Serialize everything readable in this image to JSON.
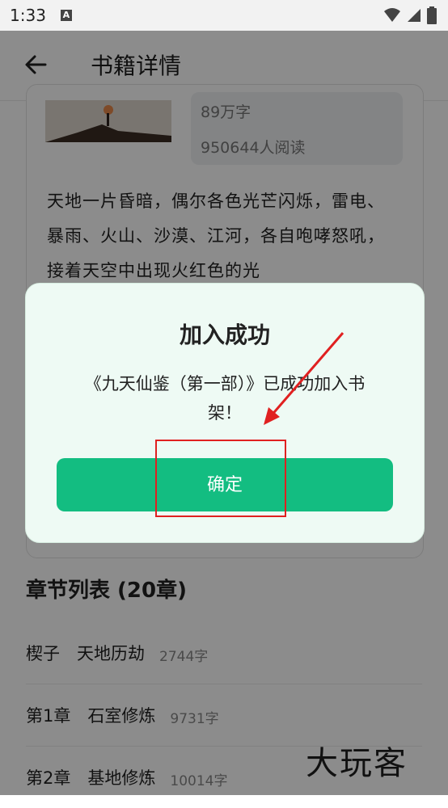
{
  "status_bar": {
    "time": "1:33",
    "notif_letter": "A"
  },
  "app_bar": {
    "title": "书籍详情",
    "back_icon": "arrow-left-icon"
  },
  "book": {
    "word_count": "89万字",
    "readers": "950644人阅读",
    "description": "天地一片昏暗，偶尔各色光芒闪烁，雷电、暴雨、火山、沙漠、江河，各自咆哮怒吼，接着天空中出现火红色的光"
  },
  "chapters": {
    "title": "章节列表 (20章)",
    "items": [
      {
        "name": "楔子　天地历劫",
        "words": "2744字"
      },
      {
        "name": "第1章　石室修炼",
        "words": "9731字"
      },
      {
        "name": "第2章　基地修炼",
        "words": "10014字"
      }
    ]
  },
  "dialog": {
    "title": "加入成功",
    "message": "《九天仙鉴（第一部）》已成功加入书架！",
    "confirm_label": "确定"
  },
  "watermark": "大玩客",
  "colors": {
    "accent": "#13bd81",
    "annotation": "#e02020"
  }
}
